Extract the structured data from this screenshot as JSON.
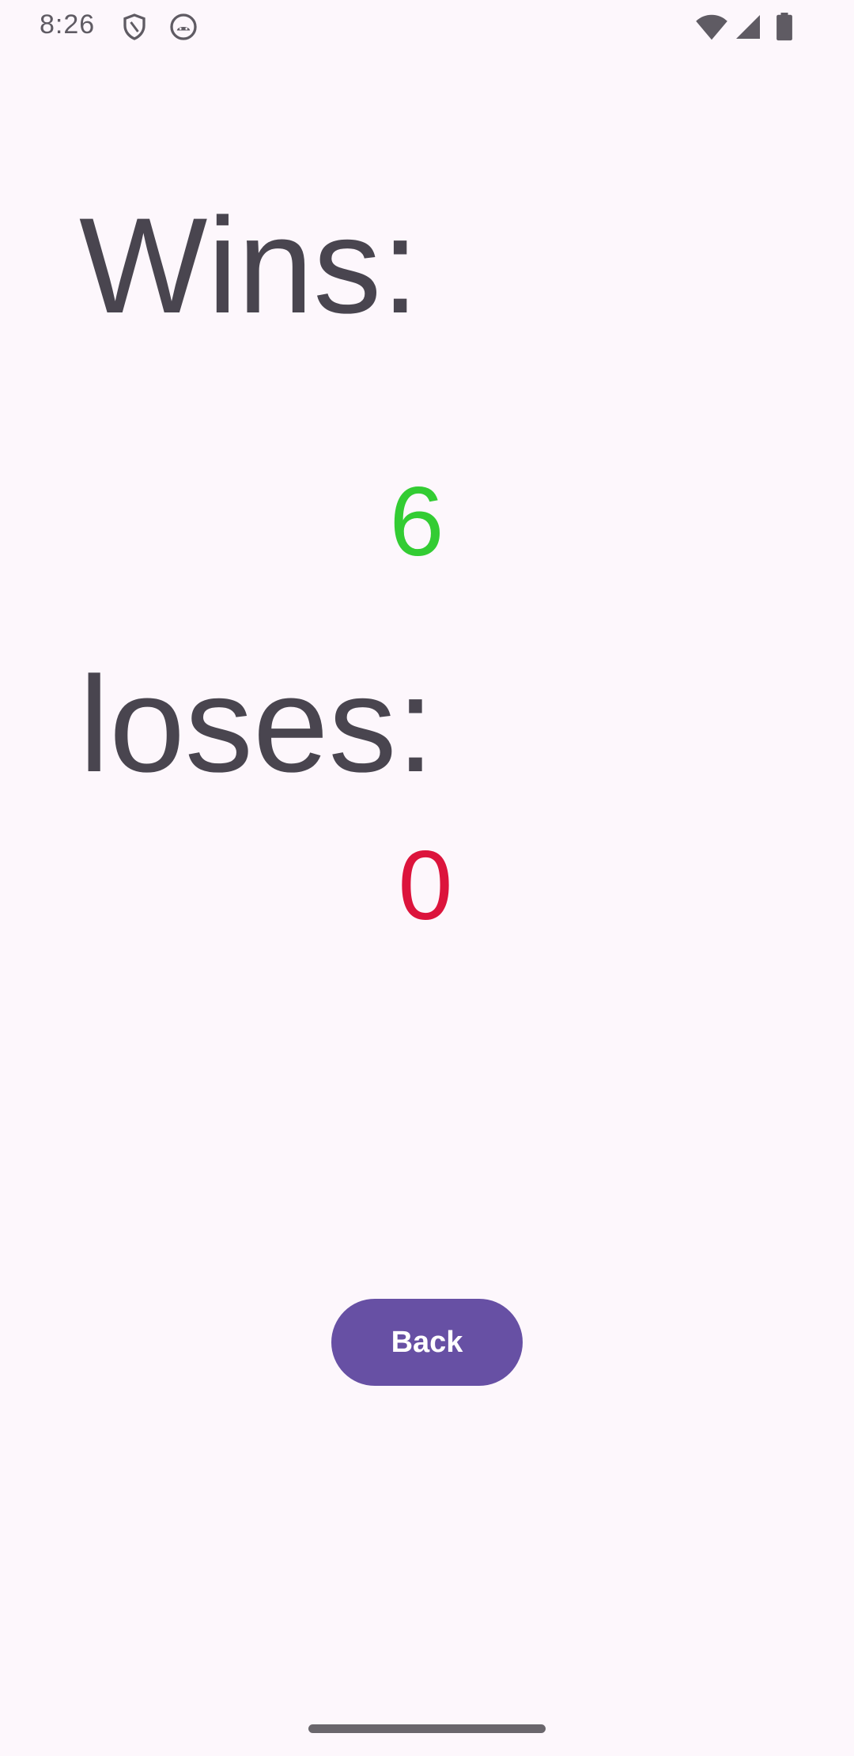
{
  "status_bar": {
    "time": "8:26",
    "icons": [
      "shield-icon",
      "android-face-icon",
      "wifi-icon",
      "cell-signal-icon",
      "battery-icon"
    ]
  },
  "stats": {
    "wins_label": "Wins:",
    "wins_value": "6",
    "loses_label": "loses:",
    "loses_value": "0"
  },
  "actions": {
    "back_label": "Back"
  },
  "colors": {
    "background": "#fdf7fc",
    "label_text": "#49454f",
    "wins_value": "#33cc33",
    "loses_value": "#dc143c",
    "button": "#6750a4",
    "button_text": "#ffffff"
  }
}
